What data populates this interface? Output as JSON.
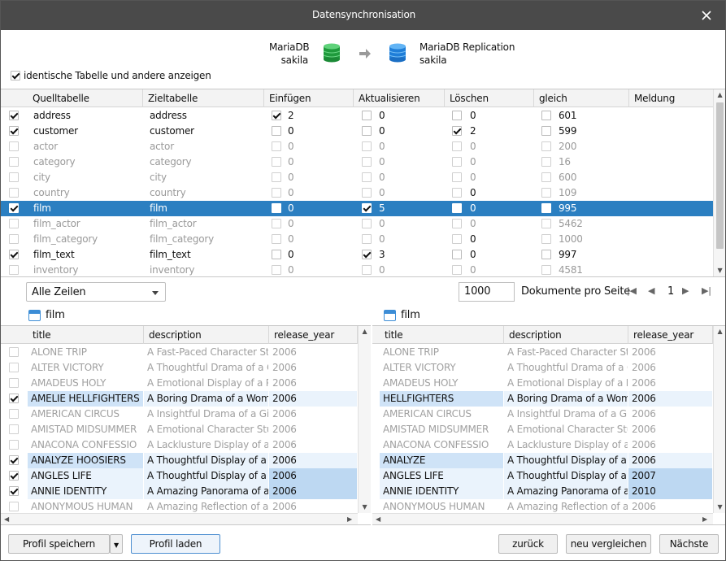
{
  "window": {
    "title": "Datensynchronisation"
  },
  "source": {
    "server": "MariaDB",
    "schema": "sakila",
    "color": "#25a244"
  },
  "target": {
    "server": "MariaDB Replication",
    "schema": "sakila",
    "color": "#2a8fe0"
  },
  "option": {
    "label": "identische Tabelle und andere anzeigen",
    "checked": true
  },
  "main_table": {
    "headers": [
      "Quelltabelle",
      "Zieltabelle",
      "Einfügen",
      "Aktualisieren",
      "Löschen",
      "gleich",
      "Meldung"
    ],
    "rows": [
      {
        "on": true,
        "src": "address",
        "dst": "address",
        "ins": "2",
        "ins_on": true,
        "upd": "0",
        "upd_on": false,
        "del": "0",
        "del_on": false,
        "eq": "601",
        "dim": false,
        "sel": false
      },
      {
        "on": true,
        "src": "customer",
        "dst": "customer",
        "ins": "0",
        "ins_on": false,
        "upd": "0",
        "upd_on": false,
        "del": "2",
        "del_on": true,
        "eq": "599",
        "dim": false,
        "sel": false
      },
      {
        "on": false,
        "src": "actor",
        "dst": "actor",
        "ins": "0",
        "ins_on": false,
        "upd": "0",
        "upd_on": false,
        "del": "0",
        "del_on": false,
        "eq": "200",
        "dim": true,
        "sel": false
      },
      {
        "on": false,
        "src": "category",
        "dst": "category",
        "ins": "0",
        "ins_on": false,
        "upd": "0",
        "upd_on": false,
        "del": "0",
        "del_on": false,
        "eq": "16",
        "dim": true,
        "sel": false
      },
      {
        "on": false,
        "src": "city",
        "dst": "city",
        "ins": "0",
        "ins_on": false,
        "upd": "0",
        "upd_on": false,
        "del": "0",
        "del_on": false,
        "eq": "600",
        "dim": true,
        "sel": false
      },
      {
        "on": false,
        "src": "country",
        "dst": "country",
        "ins": "0",
        "ins_on": false,
        "upd": "0",
        "upd_on": false,
        "del": "0",
        "del_on": false,
        "eq": "109",
        "dim": true,
        "sel": false,
        "del_dark": true
      },
      {
        "on": true,
        "src": "film",
        "dst": "film",
        "ins": "0",
        "ins_on": false,
        "upd": "5",
        "upd_on": true,
        "del": "0",
        "del_on": false,
        "eq": "995",
        "dim": false,
        "sel": true
      },
      {
        "on": false,
        "src": "film_actor",
        "dst": "film_actor",
        "ins": "0",
        "ins_on": false,
        "upd": "0",
        "upd_on": false,
        "del": "0",
        "del_on": false,
        "eq": "5462",
        "dim": true,
        "sel": false
      },
      {
        "on": false,
        "src": "film_category",
        "dst": "film_category",
        "ins": "0",
        "ins_on": false,
        "upd": "0",
        "upd_on": false,
        "del": "0",
        "del_on": false,
        "eq": "1000",
        "dim": true,
        "sel": false,
        "del_dark": true
      },
      {
        "on": true,
        "src": "film_text",
        "dst": "film_text",
        "ins": "0",
        "ins_on": false,
        "upd": "3",
        "upd_on": true,
        "del": "0",
        "del_on": false,
        "eq": "997",
        "dim": false,
        "sel": false
      },
      {
        "on": false,
        "src": "inventory",
        "dst": "inventory",
        "ins": "0",
        "ins_on": false,
        "upd": "0",
        "upd_on": false,
        "del": "0",
        "del_on": false,
        "eq": "4581",
        "dim": true,
        "sel": false
      }
    ]
  },
  "filter": {
    "selected": "Alle Zeilen"
  },
  "paging": {
    "page_size": "1000",
    "label": "Dokumente pro Seite",
    "page": "1"
  },
  "left_table": {
    "name": "film"
  },
  "right_table": {
    "name": "film"
  },
  "detail_headers": [
    "title",
    "description",
    "release_year"
  ],
  "left_rows": [
    {
      "on": false,
      "state": "dim",
      "title": "ALONE TRIP",
      "desc": "A Fast-Paced Character Study",
      "year": "2006"
    },
    {
      "on": false,
      "state": "dim",
      "title": "ALTER VICTORY",
      "desc": "A Thoughtful Drama of a Composer",
      "year": "2006"
    },
    {
      "on": false,
      "state": "dim",
      "title": "AMADEUS HOLY",
      "desc": "A Emotional Display of a Pioneer",
      "year": "2006"
    },
    {
      "on": true,
      "state": "lite",
      "title": "AMELIE HELLFIGHTERS",
      "desc": "A Boring Drama of a Woman",
      "year": "2006",
      "hl": [
        0
      ]
    },
    {
      "on": false,
      "state": "dim",
      "title": "AMERICAN CIRCUS",
      "desc": "A Insightful Drama of a Girl",
      "year": "2006"
    },
    {
      "on": false,
      "state": "dim",
      "title": "AMISTAD MIDSUMMER",
      "desc": "A Emotional Character Study",
      "year": "2006"
    },
    {
      "on": false,
      "state": "dim",
      "title": "ANACONA CONFESSIO",
      "desc": "A Lacklusture Display of a Dentist",
      "year": "2006"
    },
    {
      "on": true,
      "state": "lite",
      "title": "ANALYZE HOOSIERS",
      "desc": "A Thoughtful Display of a Explorer",
      "year": "2006",
      "hl": [
        0
      ]
    },
    {
      "on": true,
      "state": "lite",
      "title": "ANGLES LIFE",
      "desc": "A Thoughtful Display of a Woman",
      "year": "2006",
      "hl": [
        2
      ]
    },
    {
      "on": true,
      "state": "lite",
      "title": "ANNIE IDENTITY",
      "desc": "A Amazing Panorama of a Pastry Chef",
      "year": "2006",
      "hl": [
        2
      ]
    },
    {
      "on": false,
      "state": "dim",
      "title": "ANONYMOUS HUMAN",
      "desc": "A Amazing Reflection of a",
      "year": "2006"
    }
  ],
  "right_rows": [
    {
      "state": "dim",
      "title": "ALONE TRIP",
      "desc": "A Fast-Paced Character Study",
      "year": "2006"
    },
    {
      "state": "dim",
      "title": "ALTER VICTORY",
      "desc": "A Thoughtful Drama of a Composer",
      "year": "2006"
    },
    {
      "state": "dim",
      "title": "AMADEUS HOLY",
      "desc": "A Emotional Display of a Pioneer",
      "year": "2006"
    },
    {
      "state": "lite",
      "title": "HELLFIGHTERS",
      "desc": "A Boring Drama of a Woman",
      "year": "2006",
      "hl": [
        0
      ]
    },
    {
      "state": "dim",
      "title": "AMERICAN CIRCUS",
      "desc": "A Insightful Drama of a Girl",
      "year": "2006"
    },
    {
      "state": "dim",
      "title": "AMISTAD MIDSUMMER",
      "desc": "A Emotional Character Study",
      "year": "2006"
    },
    {
      "state": "dim",
      "title": "ANACONA CONFESSIO",
      "desc": "A Lacklusture Display of a Dentist",
      "year": "2006"
    },
    {
      "state": "lite",
      "title": "ANALYZE",
      "desc": "A Thoughtful Display of a Explorer",
      "year": "2006",
      "hl": [
        0
      ]
    },
    {
      "state": "lite",
      "title": "ANGLES LIFE",
      "desc": "A Thoughtful Display of a Woman",
      "year": "2007",
      "hl": [
        2
      ]
    },
    {
      "state": "lite",
      "title": "ANNIE IDENTITY",
      "desc": "A Amazing Panorama of a Pastry Chef",
      "year": "2010",
      "hl": [
        2
      ]
    },
    {
      "state": "dim",
      "title": "ANONYMOUS HUMAN",
      "desc": "A Amazing Reflection of a",
      "year": "2006"
    }
  ],
  "buttons": {
    "save": "Profil speichern",
    "load": "Profil laden",
    "back": "zurück",
    "compare": "neu vergleichen",
    "next": "Nächste"
  }
}
